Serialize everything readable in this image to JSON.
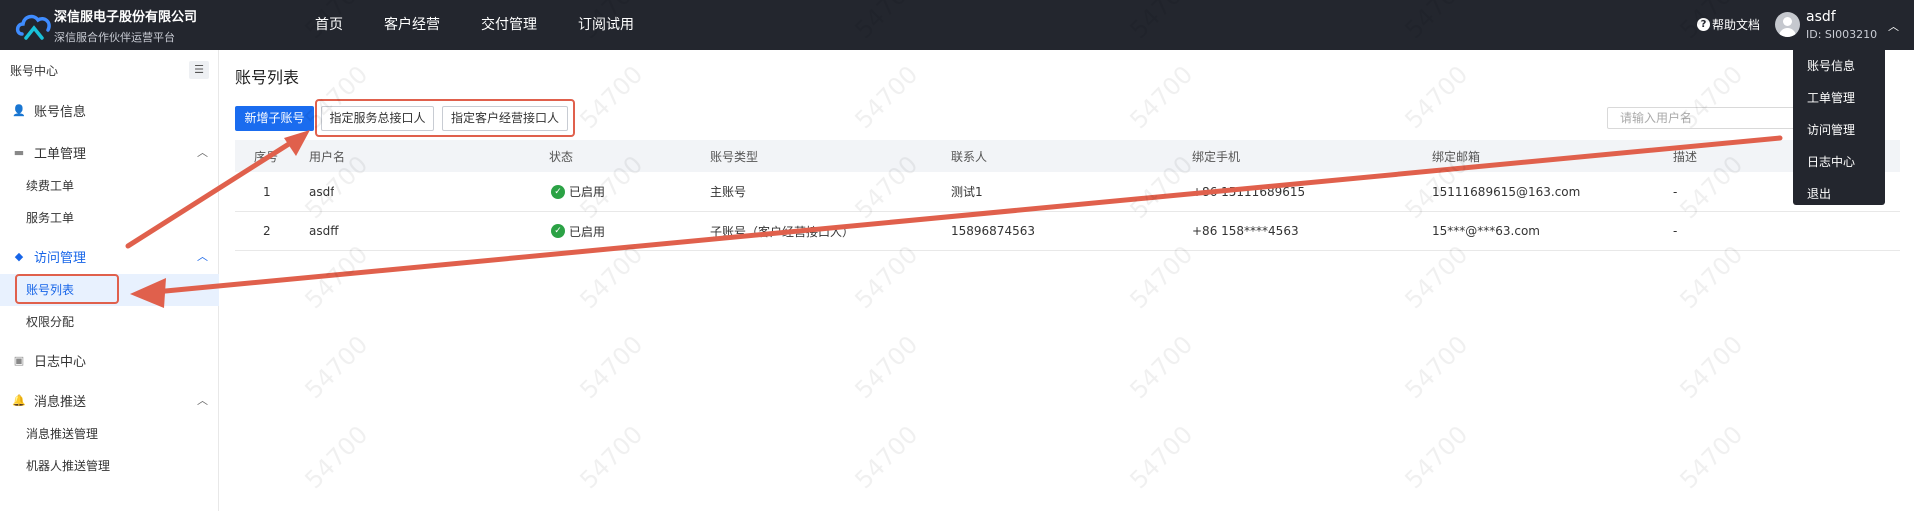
{
  "header": {
    "brand_name": "深信服电子股份有限公司",
    "brand_sub": "深信服合作伙伴运营平台",
    "nav": [
      "首页",
      "客户经营",
      "交付管理",
      "订阅试用"
    ],
    "help_label": "帮助文档",
    "user_name": "asdf",
    "user_id": "ID: SI003210"
  },
  "user_menu": [
    "账号信息",
    "工单管理",
    "访问管理",
    "日志中心",
    "退出"
  ],
  "sidebar": {
    "title": "账号中心",
    "groups": [
      {
        "icon": "user-icon",
        "label": "账号信息"
      },
      {
        "icon": "briefcase-icon",
        "label": "工单管理",
        "children": [
          "续费工单",
          "服务工单"
        ]
      },
      {
        "icon": "layers-icon",
        "label": "访问管理",
        "children": [
          "账号列表",
          "权限分配"
        ]
      },
      {
        "icon": "cube-icon",
        "label": "日志中心"
      },
      {
        "icon": "bell-icon",
        "label": "消息推送",
        "children": [
          "消息推送管理",
          "机器人推送管理"
        ]
      }
    ]
  },
  "main": {
    "title": "账号列表",
    "buttons": {
      "add": "新增子账号",
      "service": "指定服务总接口人",
      "customer": "指定客户经营接口人"
    },
    "search_placeholder": "请输入用户名",
    "table": {
      "columns": [
        "序号",
        "用户名",
        "状态",
        "账号类型",
        "联系人",
        "绑定手机",
        "绑定邮箱",
        "描述"
      ],
      "rows": [
        [
          "1",
          "asdf",
          "已启用",
          "主账号",
          "测试1",
          "+86 15111689615",
          "15111689615@163.com",
          "-"
        ],
        [
          "2",
          "asdff",
          "已启用",
          "子账号（客户经营接口人）",
          "15896874563",
          "+86 158****4563",
          "15***@***63.com",
          "-"
        ]
      ]
    }
  },
  "watermark_text": "54700",
  "colors": {
    "header_bg": "#23262e",
    "primary": "#1a6cef",
    "active": "#1765e8",
    "status_green": "#2ba245",
    "annotation": "#e0604c"
  }
}
